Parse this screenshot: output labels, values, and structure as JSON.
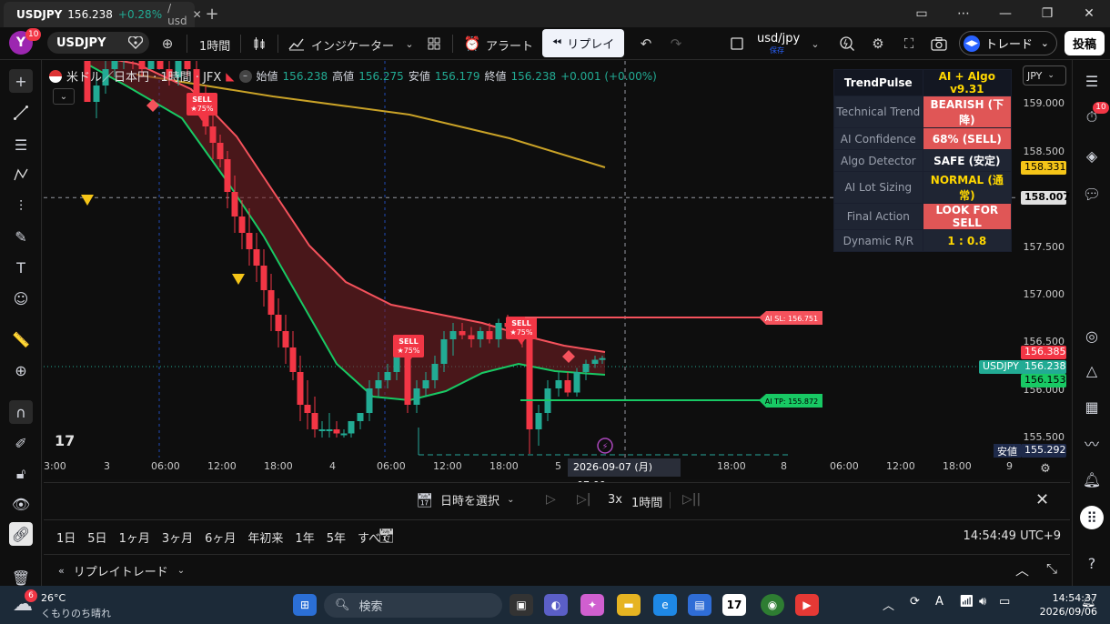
{
  "browser": {
    "tab_symbol": "USDJPY",
    "tab_price": "156.238",
    "tab_change": "+0.28%",
    "tab_rest": "/ usd",
    "new_tab": "+"
  },
  "toolbar": {
    "avatar_letter": "Y",
    "avatar_badge": "10",
    "symbol": "USDJPY",
    "interval": "1時間",
    "indicators": "インジケーター",
    "alert": "アラート",
    "replay": "リプレイ",
    "symbol2": "usd/jpy",
    "symbol2_sub": "保存",
    "trade": "トレード",
    "publish": "投稿"
  },
  "legend": {
    "title": "米ドル／日本円 · 1時間 · JFX",
    "open_label": "始値",
    "open": "156.238",
    "high_label": "高値",
    "high": "156.275",
    "low_label": "安値",
    "low": "156.179",
    "close_label": "終値",
    "close": "156.238",
    "change": "+0.001 (+0.00%)"
  },
  "trendpulse": {
    "header_key": "TrendPulse",
    "header_val": "AI + Algo v9.31",
    "rows": [
      {
        "key": "Technical Trend",
        "val": "BEARISH (下降)",
        "bg": "#e05656",
        "fg": "#ffffff"
      },
      {
        "key": "AI Confidence",
        "val": "68% (SELL)",
        "bg": "#e05656",
        "fg": "#ffffff"
      },
      {
        "key": "Algo Detector",
        "val": "SAFE (安定)",
        "bg": "#1f2533",
        "fg": "#ffffff"
      },
      {
        "key": "AI Lot Sizing",
        "val": "NORMAL (通常)",
        "bg": "#1f2533",
        "fg": "#ffd700"
      },
      {
        "key": "Final Action",
        "val": "LOOK FOR SELL",
        "bg": "#e05656",
        "fg": "#ffffff"
      },
      {
        "key": "Dynamic R/R",
        "val": "1 : 0.8",
        "bg": "#1f2533",
        "fg": "#ffd700"
      }
    ]
  },
  "price_axis": {
    "currency": "JPY",
    "labels": [
      "159.000",
      "158.500",
      "157.500",
      "157.000",
      "156.500",
      "156.000",
      "155.500"
    ],
    "tag_yellow": "158.331",
    "tag_cross": "158.007",
    "tag_red": "156.385",
    "tag_symbol": "USDJPY",
    "tag_last": "156.238",
    "tag_green": "156.153",
    "low_label": "安値",
    "low_value": "155.292"
  },
  "time_axis": {
    "labels": [
      "3:00",
      "3",
      "06:00",
      "12:00",
      "18:00",
      "4",
      "06:00",
      "12:00",
      "18:00",
      "5",
      "07:00",
      "18:00",
      "8",
      "06:00",
      "12:00",
      "18:00",
      "9"
    ],
    "cursor_date": "2026-09-07 (月)",
    "cursor_time": "07:00"
  },
  "chart": {
    "sell_label": "SELL",
    "sell_star": "★75%",
    "sl_label": "AI SL: 156.751",
    "tp_label": "AI TP: 155.872",
    "colors": {
      "up": "#22ab94",
      "down": "#f23645",
      "cloud": "#7a1f24",
      "slow": "#c9a227"
    }
  },
  "replay_bar": {
    "select_date": "日時を選択",
    "speed": "3x",
    "interval": "1時間"
  },
  "range_bar": {
    "ranges": [
      "1日",
      "5日",
      "1ヶ月",
      "3ヶ月",
      "6ヶ月",
      "年初来",
      "1年",
      "5年",
      "すべて"
    ],
    "clock": "14:54:49 UTC+9"
  },
  "bottom_panel": {
    "title": "リプレイトレード"
  },
  "taskbar": {
    "weather_badge": "6",
    "temp": "26°C",
    "weather": "くもりのち晴れ",
    "search": "検索",
    "time": "14:54:37",
    "date": "2026/09/06"
  }
}
